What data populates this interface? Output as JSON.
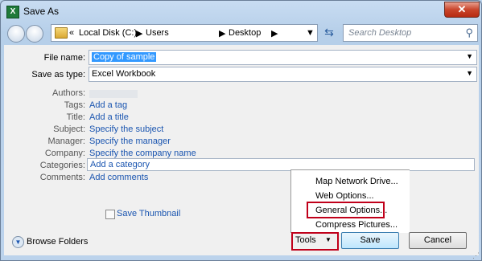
{
  "window": {
    "title": "Save As",
    "app_icon_letter": "X",
    "close_label": "✕"
  },
  "address": {
    "prefix": "«",
    "crumbs": [
      "Local Disk (C:)",
      "Users",
      "Desktop"
    ],
    "search_placeholder": "Search Desktop"
  },
  "form": {
    "file_name_label": "File name:",
    "file_name_value": "Copy of sample",
    "save_type_label": "Save as type:",
    "save_type_value": "Excel Workbook",
    "authors_label": "Authors:",
    "tags_label": "Tags:",
    "tags_value": "Add a tag",
    "title_label": "Title:",
    "title_value": "Add a title",
    "subject_label": "Subject:",
    "subject_value": "Specify the subject",
    "manager_label": "Manager:",
    "manager_value": "Specify the manager",
    "company_label": "Company:",
    "company_value": "Specify the company name",
    "categories_label": "Categories:",
    "categories_value": "Add a category",
    "comments_label": "Comments:",
    "comments_value": "Add comments",
    "save_thumbnail_label": "Save Thumbnail"
  },
  "tools_menu": {
    "items": [
      "Map Network Drive...",
      "Web Options...",
      "General Options...",
      "Compress Pictures..."
    ],
    "highlighted": "General Options..."
  },
  "footer": {
    "browse_folders": "Browse Folders",
    "tools": "Tools",
    "save": "Save",
    "cancel": "Cancel"
  },
  "colors": {
    "highlight_box": "#c0001a",
    "link": "#1a55b0",
    "selection": "#3399ff"
  }
}
